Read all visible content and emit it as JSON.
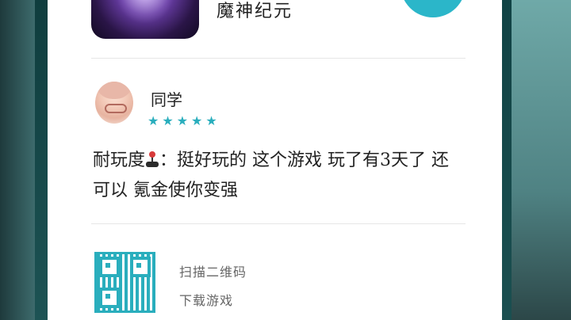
{
  "game": {
    "title": "魔神纪元"
  },
  "review": {
    "username": "同学",
    "stars": "★★★★★",
    "text_before_icon": "耐玩度",
    "text_after_icon": "：挺好玩的 这个游戏 玩了有3天了 还可以 氪金使你变强"
  },
  "footer": {
    "scan_label": "扫描二维码",
    "download_label": "下载游戏"
  },
  "colors": {
    "accent": "#2aaebd",
    "text_primary": "#222222",
    "text_secondary": "#666666"
  }
}
